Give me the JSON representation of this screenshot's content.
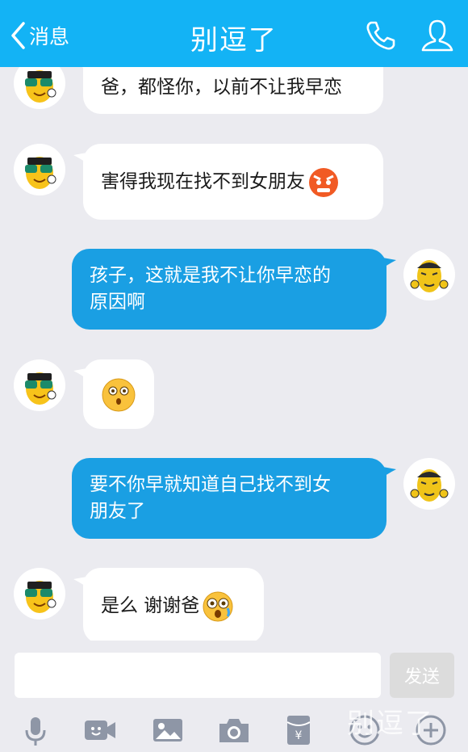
{
  "header": {
    "back_label": "消息",
    "title": "别逗了",
    "icons": [
      "phone-icon",
      "user-profile-icon"
    ]
  },
  "messages": [
    {
      "side": "in",
      "text": "爸，都怪你，以前不让我早恋"
    },
    {
      "side": "in",
      "text": "害得我现在找不到女朋友",
      "emoji": "angry-face-emoji"
    },
    {
      "side": "out",
      "line1": "孩子，这就是我不让你早恋的",
      "line2": "原因啊"
    },
    {
      "side": "in",
      "emoji": "surprised-face-emoji"
    },
    {
      "side": "out",
      "line1": "要不你早就知道自己找不到女",
      "line2": "朋友了"
    },
    {
      "side": "in",
      "text": "是么 谢谢爸",
      "emoji": "shocked-face-emoji"
    }
  ],
  "input": {
    "placeholder": "",
    "value": ""
  },
  "send_label": "发送",
  "toolbar": [
    "microphone-icon",
    "video-call-icon",
    "image-icon",
    "camera-icon",
    "red-envelope-icon",
    "emoji-icon",
    "plus-icon"
  ],
  "watermark": "别逗了",
  "colors": {
    "header": "#13b3f5",
    "out_bubble": "#1a9fe3",
    "background": "#ebebf0"
  }
}
